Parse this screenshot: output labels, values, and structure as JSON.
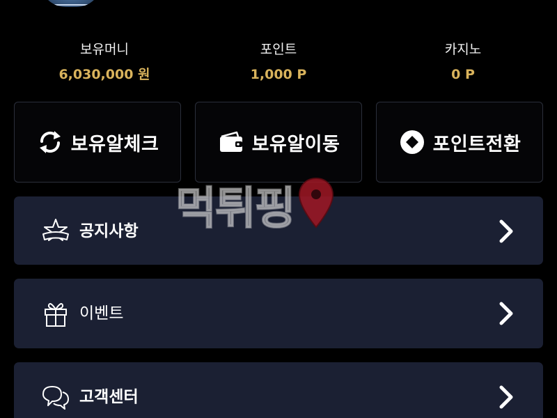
{
  "balances": [
    {
      "label": "보유머니",
      "value": "6,030,000 원"
    },
    {
      "label": "포인트",
      "value": "1,000 P"
    },
    {
      "label": "카지노",
      "value": "0 P"
    }
  ],
  "actions": {
    "check_label": "보유알체크",
    "move_label": "보유알이동",
    "convert_label": "포인트전환"
  },
  "menu": {
    "notice_label": "공지사항",
    "event_label": "이벤트",
    "support_label": "고객센터"
  },
  "watermark": {
    "text": "먹튀핑"
  },
  "colors": {
    "background": "#000000",
    "value_gold": "#d9b35c",
    "menu_row_bg": "#1b2033",
    "action_border": "#2b2f3b",
    "watermark_pin": "#a01824"
  },
  "icons": {
    "check": "refresh-arrows-icon",
    "move": "wallet-icon",
    "convert": "diamond-coin-icon",
    "notice": "star-banner-icon",
    "event": "gift-icon",
    "support": "chat-bubbles-icon",
    "row_arrow": "chevron-right-icon"
  }
}
